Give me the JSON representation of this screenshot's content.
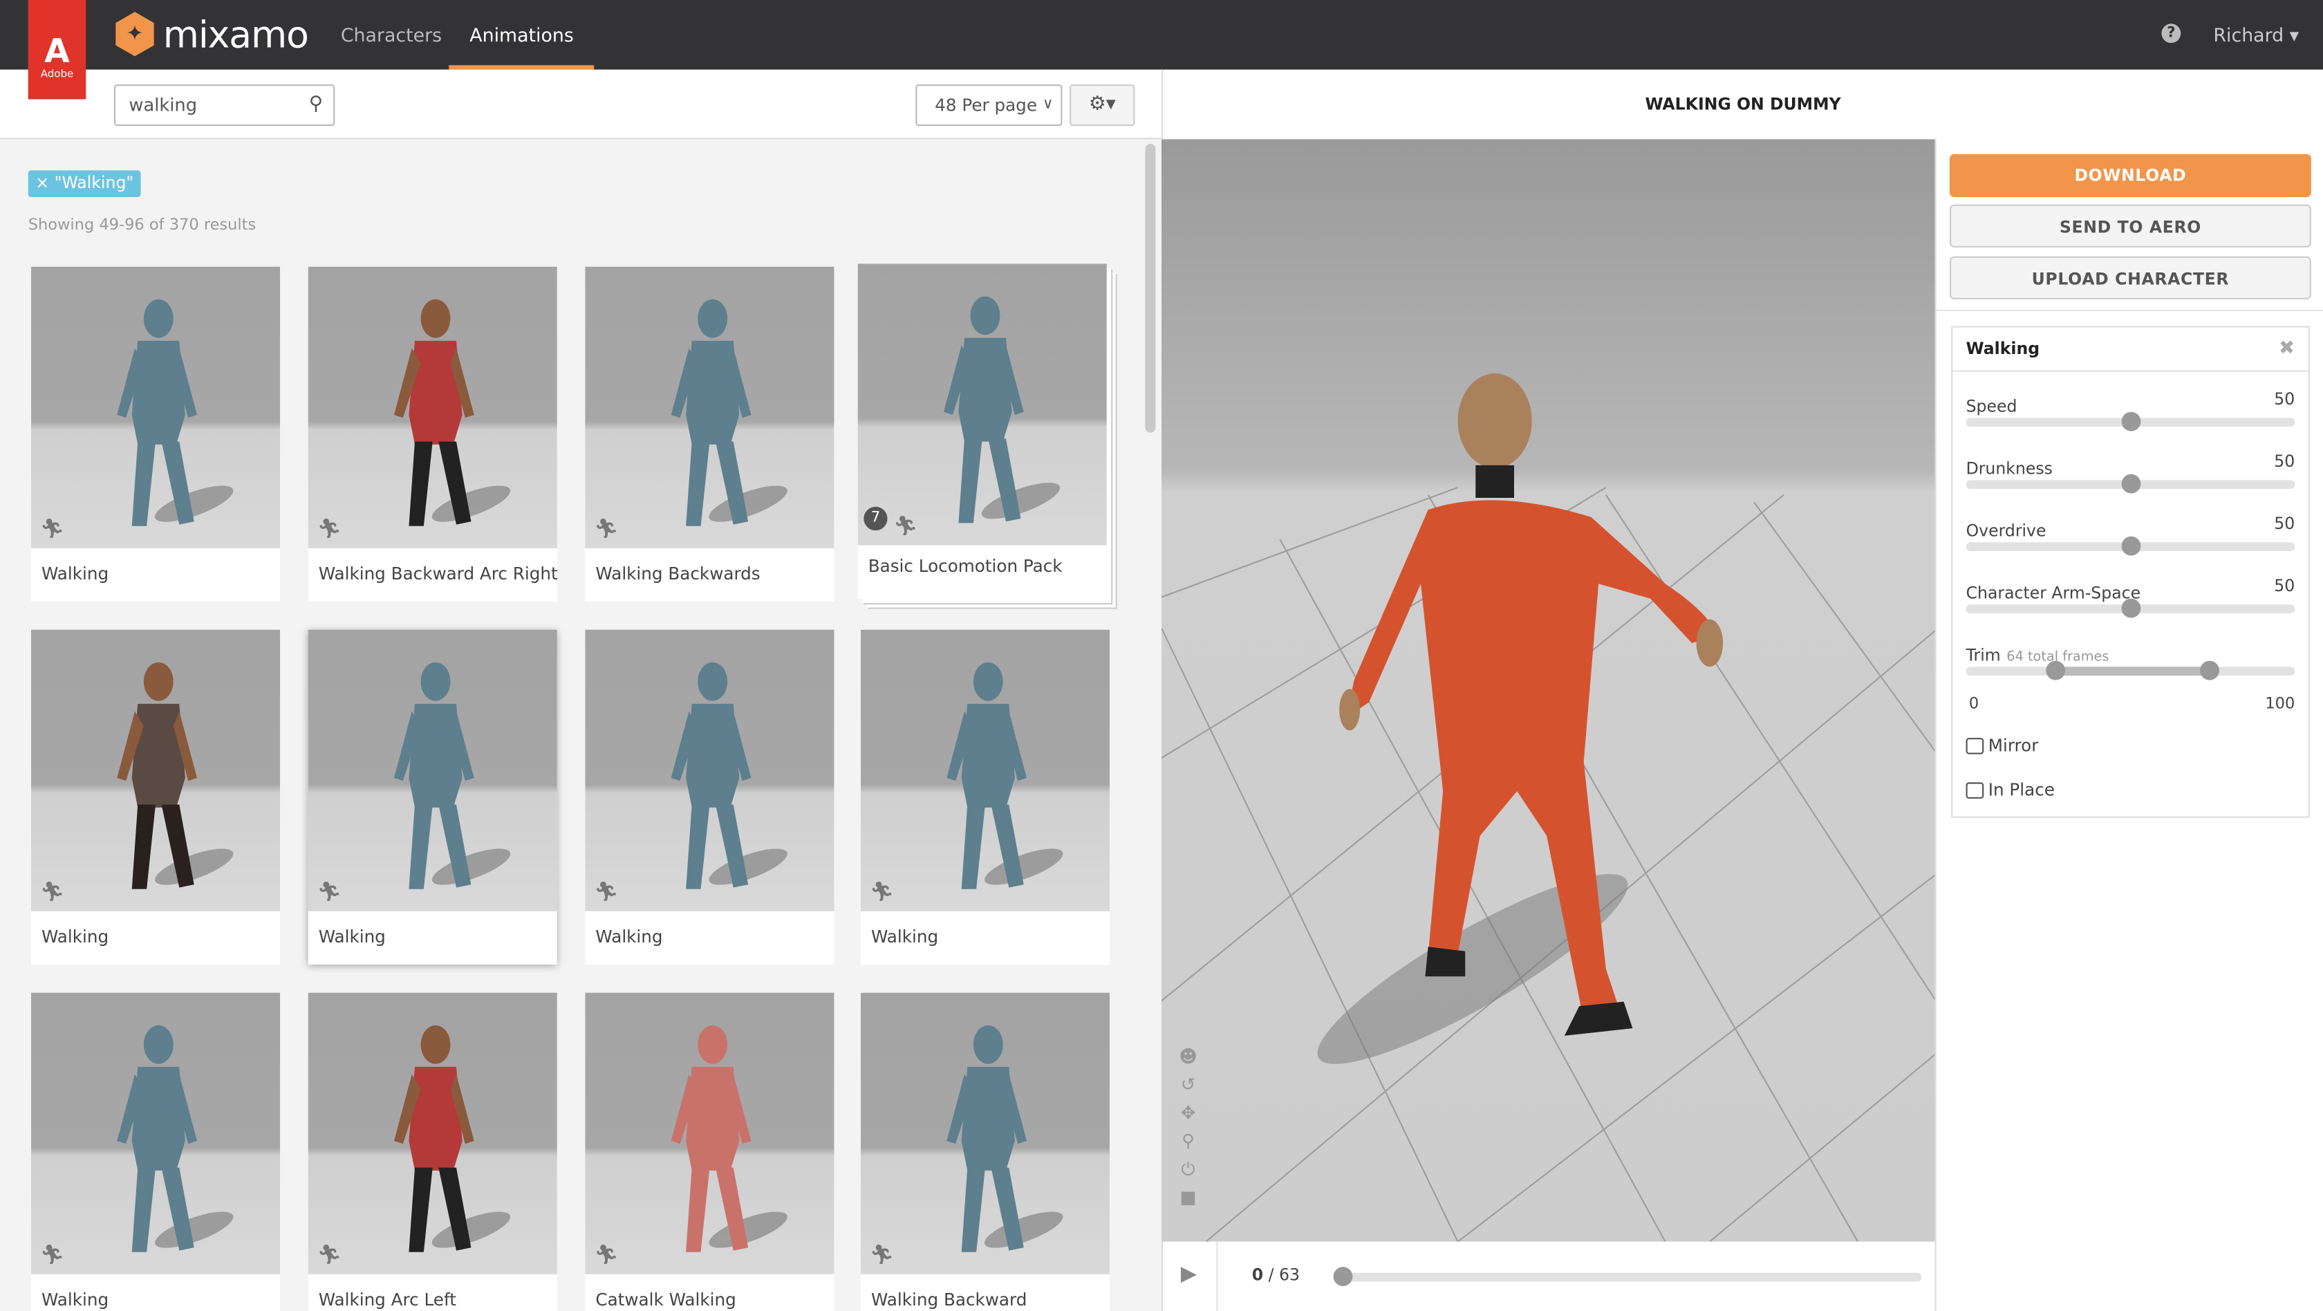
{
  "header": {
    "brand": "Adobe",
    "logo_text": "mixamo",
    "nav": [
      {
        "label": "Characters",
        "active": false
      },
      {
        "label": "Animations",
        "active": true
      }
    ],
    "help_icon": "?",
    "user": "Richard ▾",
    "accent": "#f0954a"
  },
  "toolbar": {
    "search_value": "walking",
    "per_page": "48 Per page",
    "gear": "⚙▾"
  },
  "filter": {
    "tag": "× \"Walking\"",
    "showing": "Showing 49-96 of 370 results"
  },
  "cards": [
    {
      "label": "Walking",
      "fig": "bot"
    },
    {
      "label": "Walking Backward Arc Right",
      "fig": "woman"
    },
    {
      "label": "Walking Backwards",
      "fig": "bot"
    },
    {
      "label": "Basic Locomotion Pack",
      "fig": "bot",
      "badge": "7",
      "pack": true
    },
    {
      "label": "Walking",
      "fig": "zombie"
    },
    {
      "label": "Walking",
      "fig": "bot",
      "selected": true
    },
    {
      "label": "Walking",
      "fig": "bot"
    },
    {
      "label": "Walking",
      "fig": "bot"
    },
    {
      "label": "Walking",
      "fig": "bot"
    },
    {
      "label": "Walking Arc Left",
      "fig": "woman"
    },
    {
      "label": "Catwalk Walking",
      "fig": "pink"
    },
    {
      "label": "Walking Backward",
      "fig": "bot"
    }
  ],
  "viewer": {
    "title": "WALKING ON DUMMY",
    "frame_current": "0",
    "frame_total": "/ 63",
    "progress": 0
  },
  "sidebar": {
    "download": "DOWNLOAD",
    "send": "SEND TO AERO",
    "upload": "UPLOAD CHARACTER",
    "panel_title": "Walking",
    "sliders": [
      {
        "name": "Speed",
        "value": 50
      },
      {
        "name": "Drunkness",
        "value": 50
      },
      {
        "name": "Overdrive",
        "value": 50
      },
      {
        "name": "Character Arm-Space",
        "value": 50
      }
    ],
    "trim": {
      "name": "Trim",
      "sub": "64 total frames",
      "min_label": "0",
      "max_label": "100",
      "start": 27,
      "end": 74
    },
    "mirror": "Mirror",
    "in_place": "In Place"
  }
}
